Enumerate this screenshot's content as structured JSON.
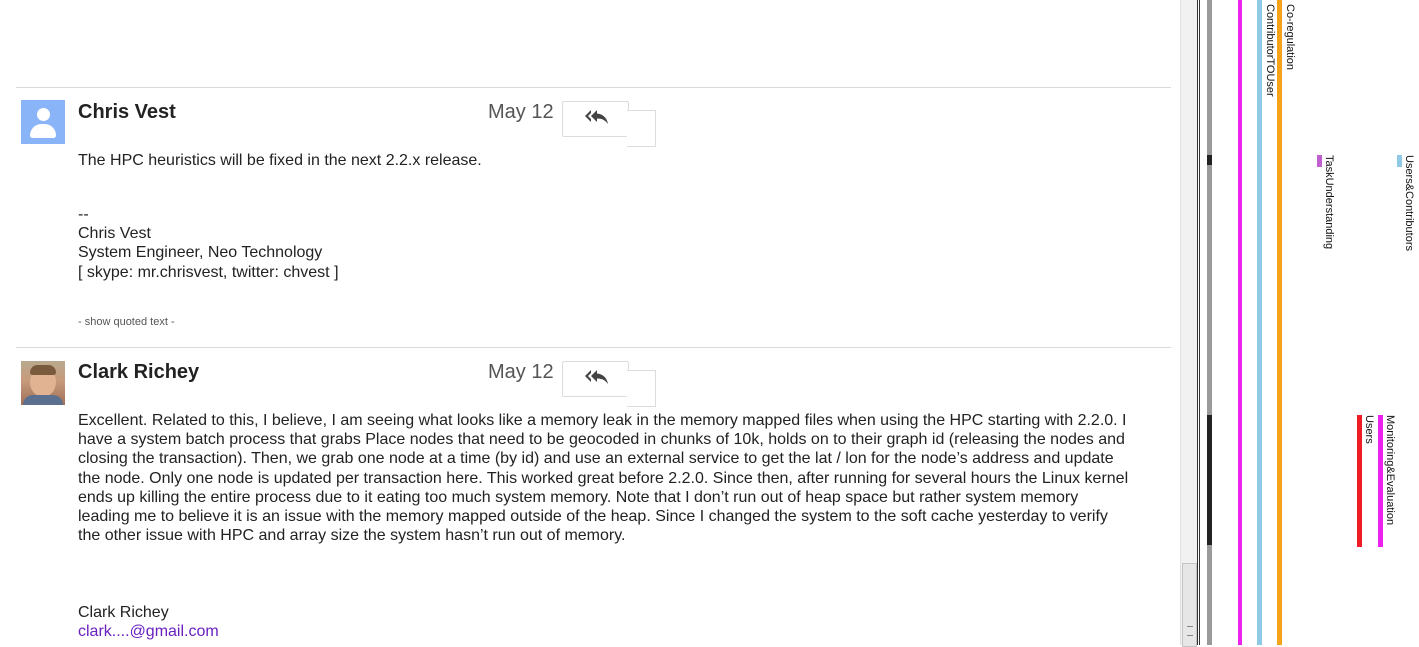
{
  "messages": [
    {
      "sender": "Chris Vest",
      "date": "May 12",
      "body": "The HPC heuristics will be fixed in the next 2.2.x release.",
      "signature": [
        "--",
        "Chris Vest",
        "System Engineer, Neo Technology",
        "[ skype: mr.chrisvest, twitter: chvest ]"
      ],
      "show_quoted": "- show quoted text -"
    },
    {
      "sender": "Clark Richey",
      "date": "May 12",
      "body_lines": [
        "Excellent. Related to this, I believe, I am seeing what looks like a memory leak in the memory mapped files when using the HPC starting with 2.2.0. I",
        "have a system batch process that grabs Place nodes that need to be geocoded in chunks of 10k, holds on to their graph id (releasing the nodes and",
        "closing the transaction). Then, we grab one node at a time (by id) and use an external service to get the lat / lon for the node’s address and update",
        "the node. Only one node is updated per transaction here. This worked great before 2.2.0. Since then, after running for several hours the Linux kernel",
        "ends up killing the entire process due to it eating too much system memory. Note that I don’t run out of heap space but rather system memory",
        "leading me to believe it is an issue with the memory mapped outside of the heap. Since I changed the system to the soft cache yesterday to verify",
        "the other issue with HPC and array size the system hasn’t run out of memory."
      ],
      "signature_name": "Clark Richey",
      "signature_email": "clark....@gmail.com"
    }
  ],
  "icons": {
    "reply": "reply-all-icon",
    "avatar_generic": "default-avatar-icon",
    "avatar_photo": "profile-photo"
  },
  "annotation_panel": {
    "labels": {
      "co_regulation": "Co-regulation",
      "contributor_to_user": "ContributorTOUser",
      "task_understanding": "TaskUnderstanding",
      "users_contributors": "Users&Contributors",
      "monitoring_evaluation": "Monitoring&Evaluation",
      "users": "Users"
    },
    "colors": {
      "magenta": "#ee22ee",
      "light_blue": "#8ecae6",
      "orange": "#f7a21b",
      "purple": "#c060d0",
      "red": "#ee1c24"
    }
  }
}
